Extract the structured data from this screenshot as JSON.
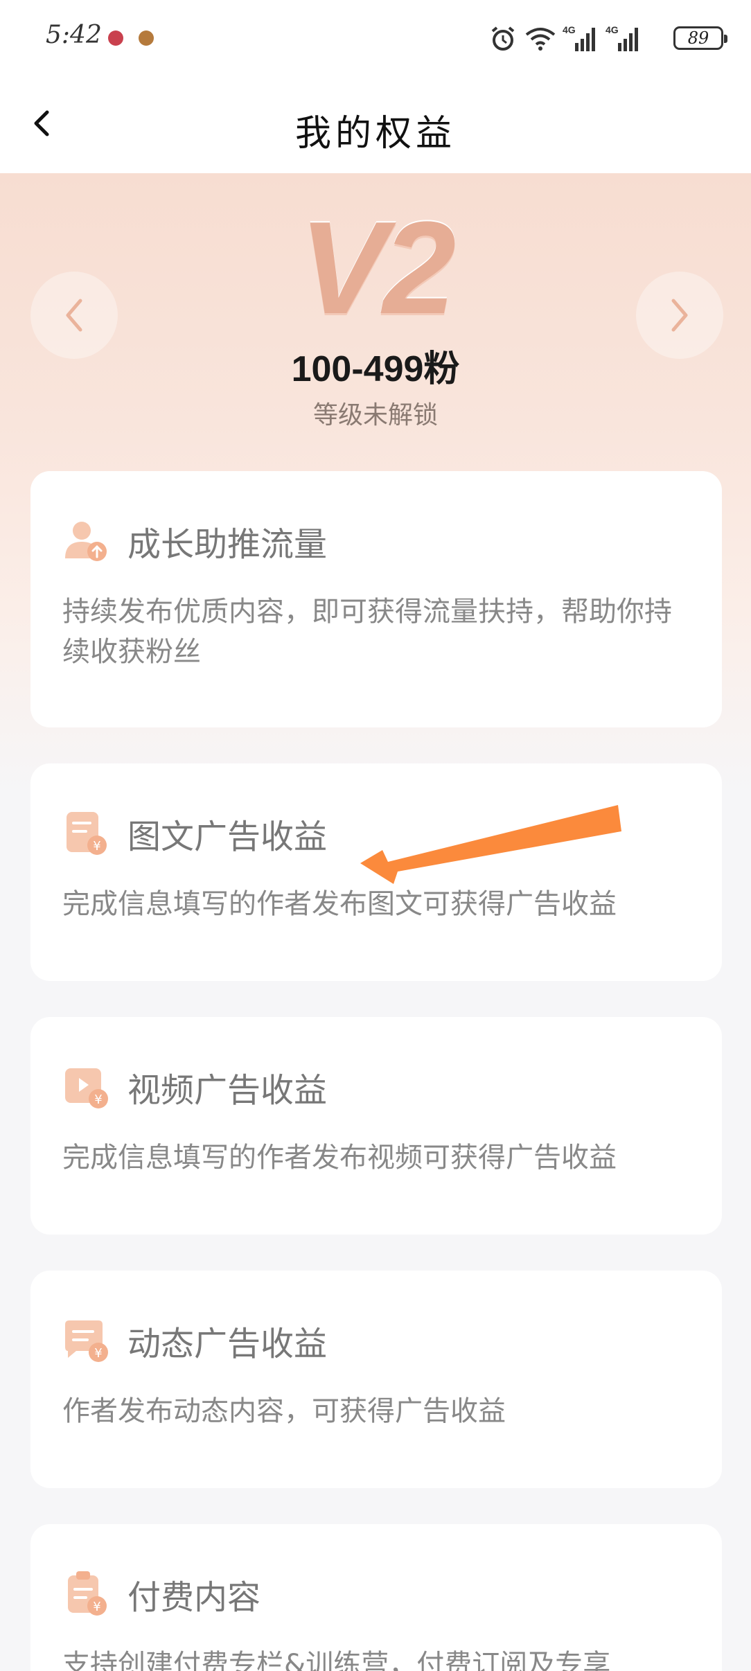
{
  "status_bar": {
    "time": "5:42",
    "battery": "89",
    "icons": [
      "alarm-icon",
      "wifi-icon",
      "signal-4g-icon",
      "signal-4g-icon-2"
    ]
  },
  "nav": {
    "title": "我的权益"
  },
  "level": {
    "badge": "V2",
    "range": "100-499粉",
    "status": "等级未解锁"
  },
  "benefits": [
    {
      "icon": "user-boost-icon",
      "title": "成长助推流量",
      "desc": "持续发布优质内容，即可获得流量扶持，帮助你持续收获粉丝"
    },
    {
      "icon": "article-yuan-icon",
      "title": "图文广告收益",
      "desc": "完成信息填写的作者发布图文可获得广告收益"
    },
    {
      "icon": "video-yuan-icon",
      "title": "视频广告收益",
      "desc": "完成信息填写的作者发布视频可获得广告收益"
    },
    {
      "icon": "post-yuan-icon",
      "title": "动态广告收益",
      "desc": "作者发布动态内容，可获得广告收益"
    },
    {
      "icon": "paid-content-icon",
      "title": "付费内容",
      "desc": "支持创建付费专栏&训练营，付费订阅及专享"
    }
  ],
  "colors": {
    "accent_peach": "#f3b08e",
    "arrow_orange": "#fb8a3c",
    "hero_top": "#f7ddd1"
  }
}
